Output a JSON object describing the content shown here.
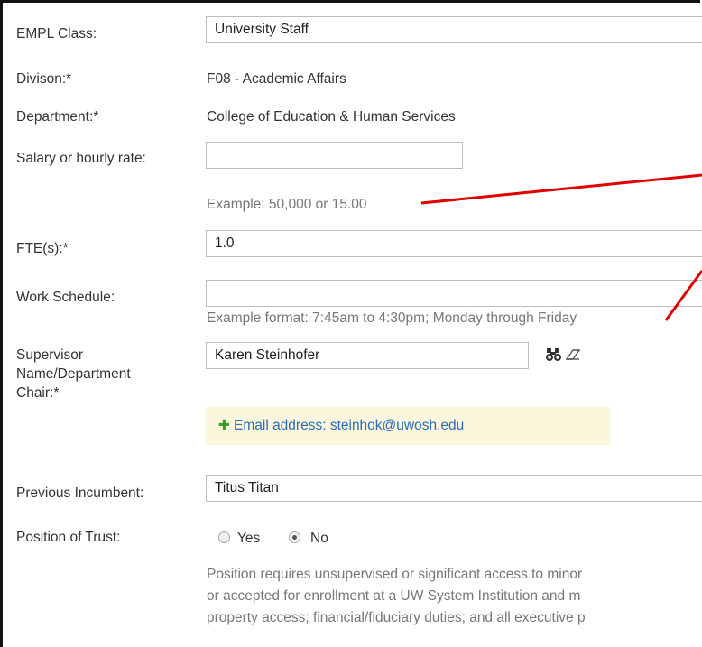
{
  "form": {
    "empl_class": {
      "label": "EMPL Class:",
      "value": "University Staff"
    },
    "division": {
      "label": "Divison:*",
      "value": "F08 - Academic Affairs"
    },
    "department": {
      "label": "Department:*",
      "value": "College of Education & Human Services"
    },
    "salary": {
      "label": "Salary or hourly rate:",
      "value": "",
      "hint": "Example: 50,000 or 15.00"
    },
    "fte": {
      "label": "FTE(s):*",
      "value": "1.0"
    },
    "work_schedule": {
      "label": "Work Schedule:",
      "value": "",
      "hint": "Example format: 7:45am to 4:30pm; Monday through Friday"
    },
    "supervisor": {
      "label_line1": "Supervisor",
      "label_line2": "Name/Department",
      "label_line3": "Chair:*",
      "value": "Karen Steinhofer",
      "email_text": "Email address: steinhok@uwosh.edu"
    },
    "previous_incumbent": {
      "label": "Previous Incumbent:",
      "value": "Titus Titan"
    },
    "position_of_trust": {
      "label": "Position of Trust:",
      "options": [
        "Yes",
        "No"
      ],
      "selected": "No",
      "description_line1": "Position requires unsupervised or significant access to minor",
      "description_line2": "or accepted for enrollment at a UW System Institution and m",
      "description_line3": "property access; financial/fiduciary duties; and all executive p"
    }
  },
  "icons": {
    "lookup": "binoculars-icon",
    "clear": "eraser-icon",
    "add": "plus-icon"
  },
  "colors": {
    "annotation_arrow": "#e00000",
    "email_box_bg": "#fbf6dc",
    "link": "#2a6db4"
  }
}
